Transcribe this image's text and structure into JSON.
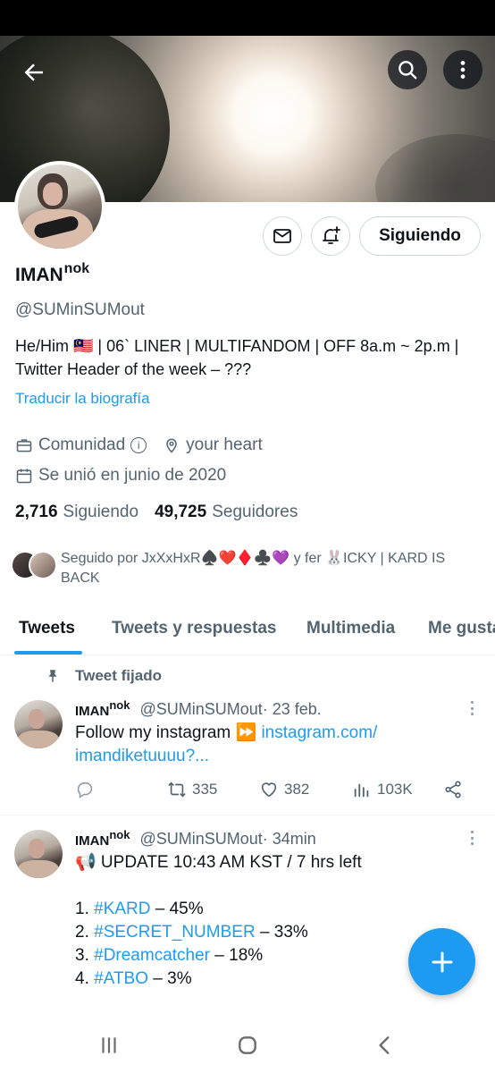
{
  "profile": {
    "name": "IMAN",
    "name_sup": "nok",
    "name_apple": "",
    "handle": "@SUMinSUMout",
    "bio_line1": "He/Him 🇲🇾 | 06` LINER | MULTIFANDOM | OFF 8a.m ~ 2p.m |",
    "bio_line2": "Twitter Header of the week – ???",
    "translate_label": "Traducir la biografía",
    "community_label": "Comunidad",
    "location": "your heart",
    "joined": "Se unió en junio de 2020",
    "following_count": "2,716",
    "following_label": "Siguiendo",
    "followers_count": "49,725",
    "followers_label": "Seguidores",
    "followed_by_line1": "Seguido por JxXxHxR♠️❤️♦️♣️💜 y fer 🐰ICKY | KARD IS",
    "followed_by_line2": "BACK"
  },
  "buttons": {
    "following_label": "Siguiendo"
  },
  "tabs": [
    {
      "label": "Tweets",
      "active": true
    },
    {
      "label": "Tweets y respuestas",
      "active": false
    },
    {
      "label": "Multimedia",
      "active": false
    },
    {
      "label": "Me gusta",
      "active": false
    }
  ],
  "pinned_label": "Tweet fijado",
  "tweets": [
    {
      "name": "IMAN",
      "name_sup": "nok",
      "handle": "@SUMinSUMout",
      "time": " · 23 feb.",
      "text": "Follow my instagram ⏩",
      "link_part1": "instagram.com/",
      "link_part2": "imandiketuuuu?...",
      "retweets": "335",
      "likes": "382",
      "views": "103K"
    },
    {
      "name": "IMAN",
      "name_sup": "nok",
      "handle": "@SUMinSUMout",
      "time": " · 34min",
      "line1": "📢 UPDATE 10:43 AM KST / 7 hrs left",
      "items": [
        {
          "num": "1. ",
          "tag": "#KARD",
          "pct": " – 45%"
        },
        {
          "num": "2. ",
          "tag": "#SECRET_NUMBER",
          "pct": " – 33%"
        },
        {
          "num": "3. ",
          "tag": "#Dreamcatcher",
          "pct": " – 18%"
        },
        {
          "num": "4. ",
          "tag": "#ATBO",
          "pct": " – 3%"
        }
      ]
    }
  ],
  "colors": {
    "accent": "#1d9bf0",
    "text_primary": "#0f1419",
    "text_secondary": "#536471"
  }
}
